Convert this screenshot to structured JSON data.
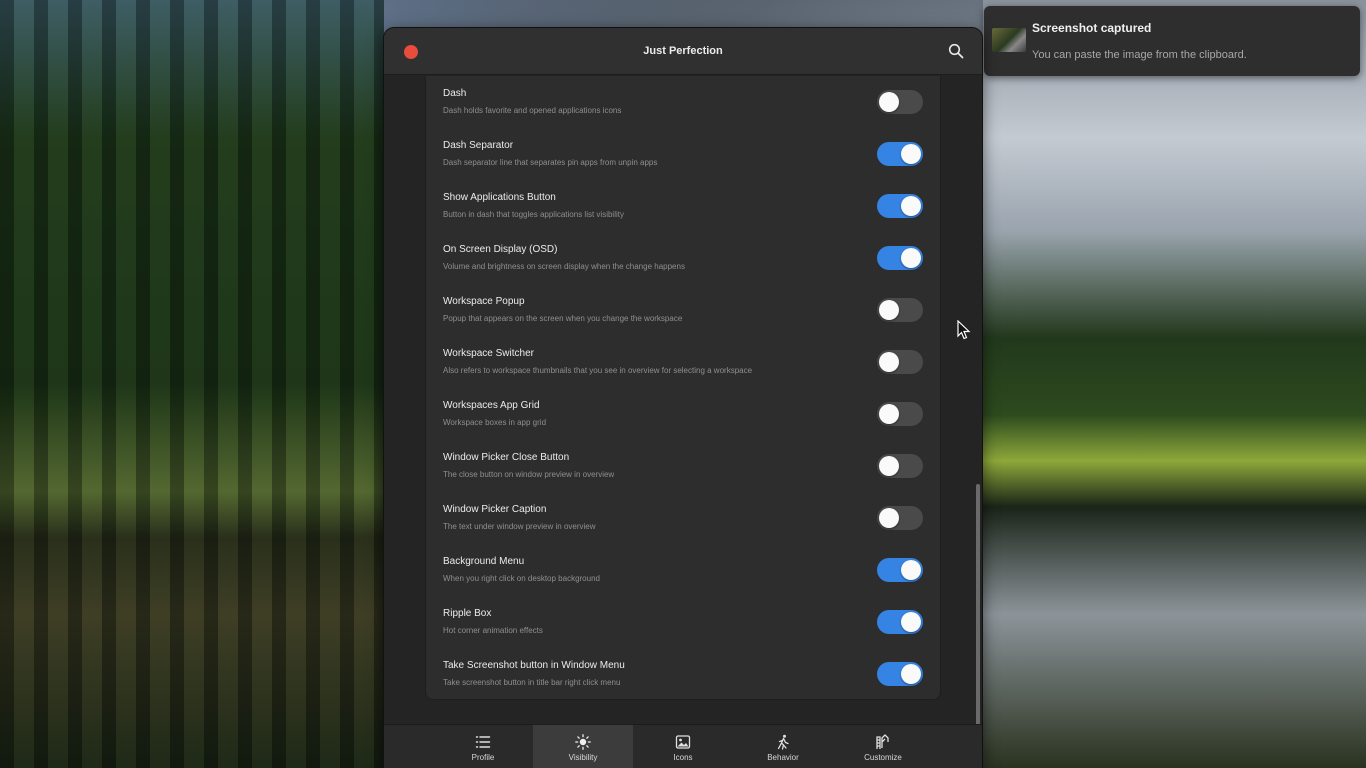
{
  "notification": {
    "title": "Screenshot captured",
    "body": "You can paste the image from the clipboard."
  },
  "window": {
    "title": "Just Perfection"
  },
  "settings": [
    {
      "title": "Dash",
      "subtitle": "Dash holds favorite and opened applications icons",
      "enabled": false
    },
    {
      "title": "Dash Separator",
      "subtitle": "Dash separator line that separates pin apps from unpin apps",
      "enabled": true
    },
    {
      "title": "Show Applications Button",
      "subtitle": "Button in dash that toggles applications list visibility",
      "enabled": true
    },
    {
      "title": "On Screen Display (OSD)",
      "subtitle": "Volume and brightness on screen display when the change happens",
      "enabled": true
    },
    {
      "title": "Workspace Popup",
      "subtitle": "Popup that appears on the screen when you change the workspace",
      "enabled": false
    },
    {
      "title": "Workspace Switcher",
      "subtitle": "Also refers to workspace thumbnails that you see in overview for selecting a workspace",
      "enabled": false
    },
    {
      "title": "Workspaces App Grid",
      "subtitle": "Workspace boxes in app grid",
      "enabled": false
    },
    {
      "title": "Window Picker Close Button",
      "subtitle": "The close button on window preview in overview",
      "enabled": false
    },
    {
      "title": "Window Picker Caption",
      "subtitle": "The text under window preview in overview",
      "enabled": false
    },
    {
      "title": "Background Menu",
      "subtitle": "When you right click on desktop background",
      "enabled": true
    },
    {
      "title": "Ripple Box",
      "subtitle": "Hot corner animation effects",
      "enabled": true
    },
    {
      "title": "Take Screenshot button in Window Menu",
      "subtitle": "Take screenshot button in title bar right click menu",
      "enabled": true
    }
  ],
  "tabs": [
    {
      "label": "Profile",
      "icon": "list-icon",
      "active": false
    },
    {
      "label": "Visibility",
      "icon": "sun-icon",
      "active": true
    },
    {
      "label": "Icons",
      "icon": "image-icon",
      "active": false
    },
    {
      "label": "Behavior",
      "icon": "walking-icon",
      "active": false
    },
    {
      "label": "Customize",
      "icon": "customize-icon",
      "active": false
    }
  ],
  "colors": {
    "accent": "#3584e4",
    "close": "#e74c3c"
  }
}
